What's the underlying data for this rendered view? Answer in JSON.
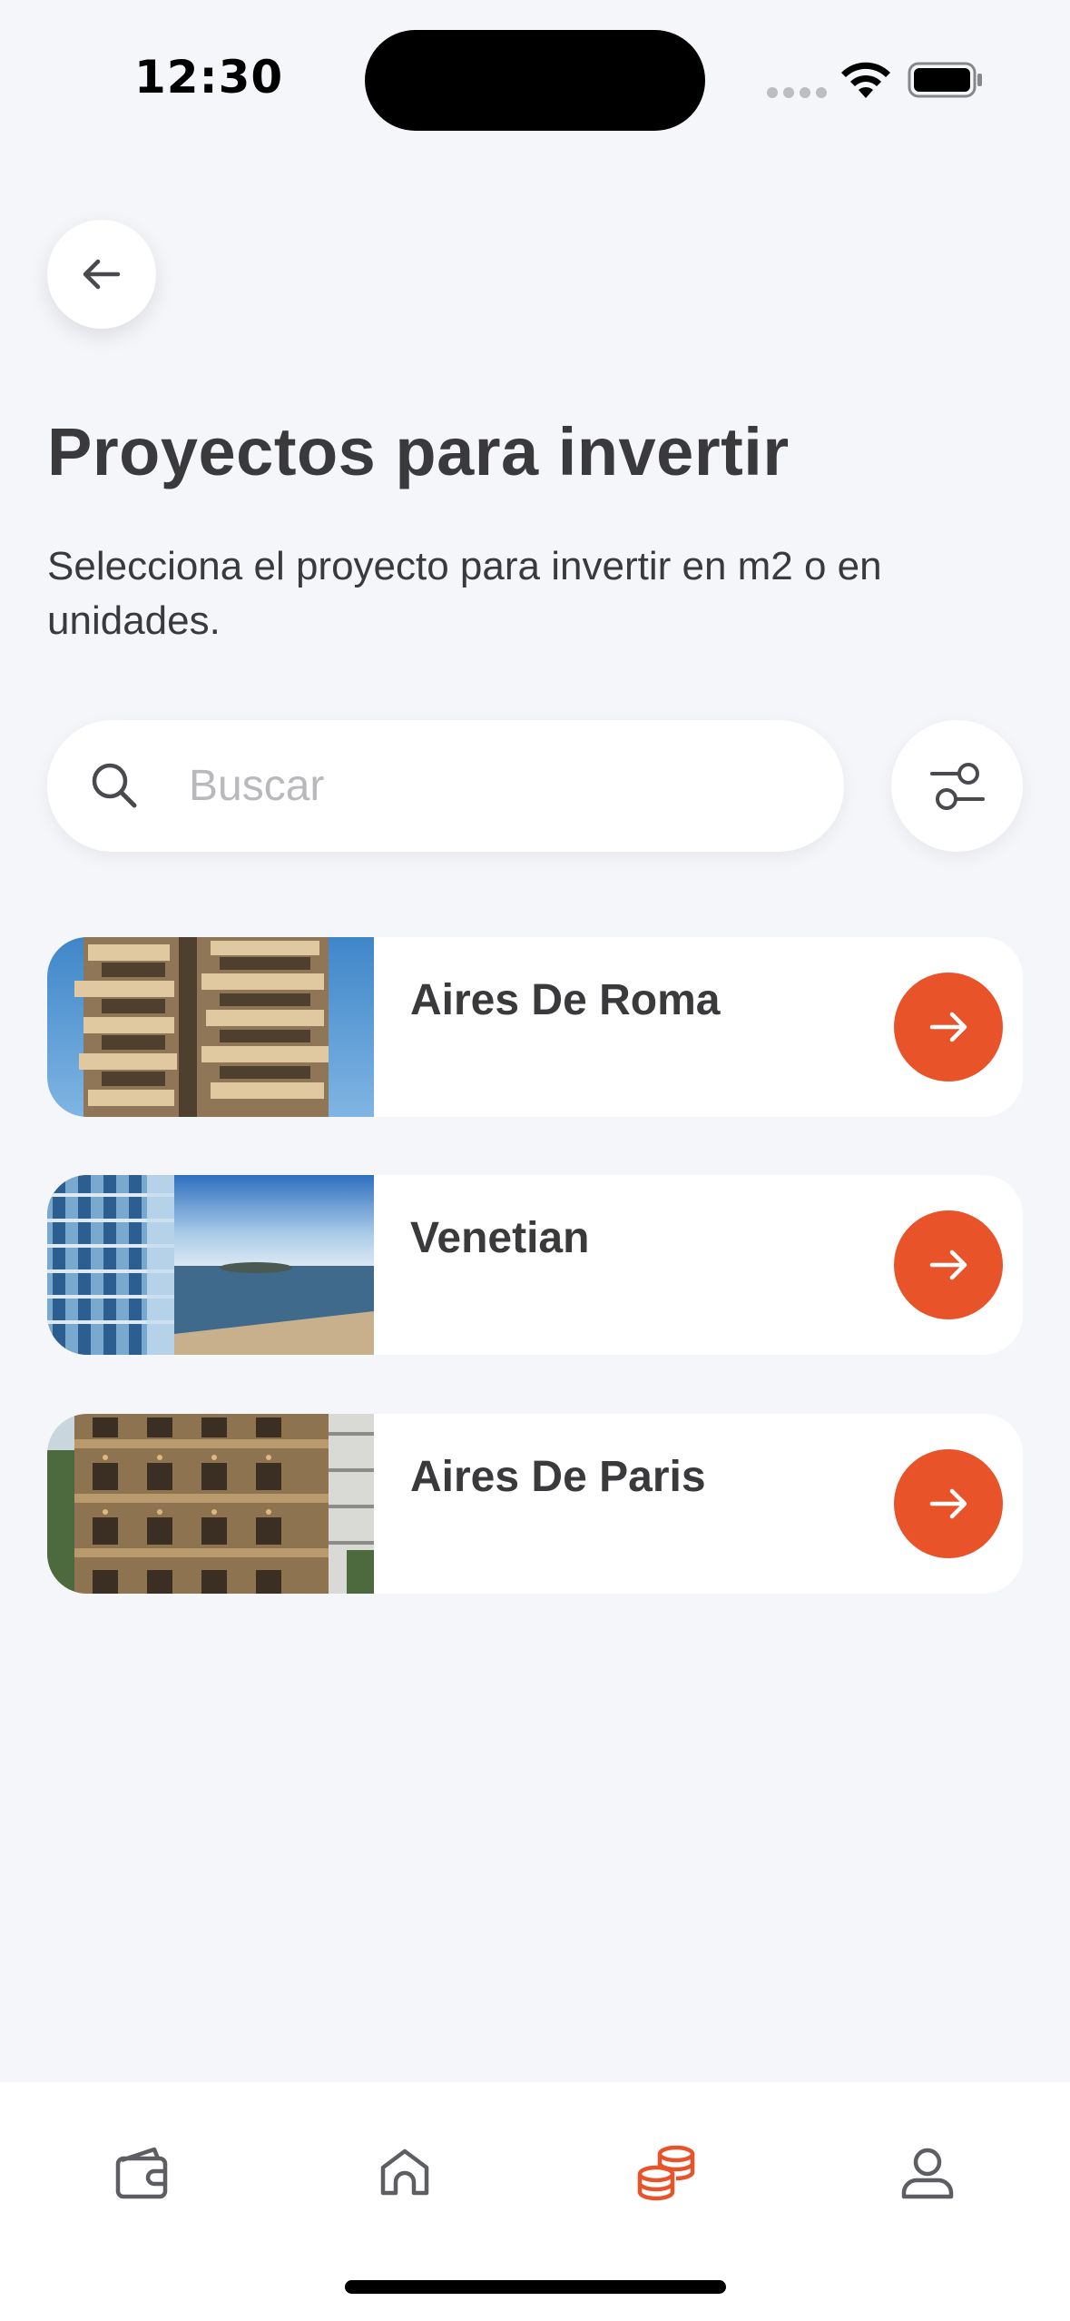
{
  "status_bar": {
    "time": "12:30"
  },
  "header": {
    "title": "Proyectos para invertir",
    "subtitle": "Selecciona el proyecto para invertir en m2 o en unidades."
  },
  "search": {
    "placeholder": "Buscar",
    "value": ""
  },
  "projects": [
    {
      "name": "Aires De Roma",
      "image": "tower-balconies-photo"
    },
    {
      "name": "Venetian",
      "image": "coastal-tower-photo"
    },
    {
      "name": "Aires De Paris",
      "image": "facade-balconies-photo"
    }
  ],
  "tab_bar": {
    "items": [
      "wallet-icon",
      "home-icon",
      "coins-stack-icon",
      "profile-icon"
    ],
    "active_index": 2
  },
  "colors": {
    "accent": "#e8532a",
    "background": "#f5f6fa",
    "text": "#3a3a3c",
    "icon_inactive": "#5e5e62"
  }
}
